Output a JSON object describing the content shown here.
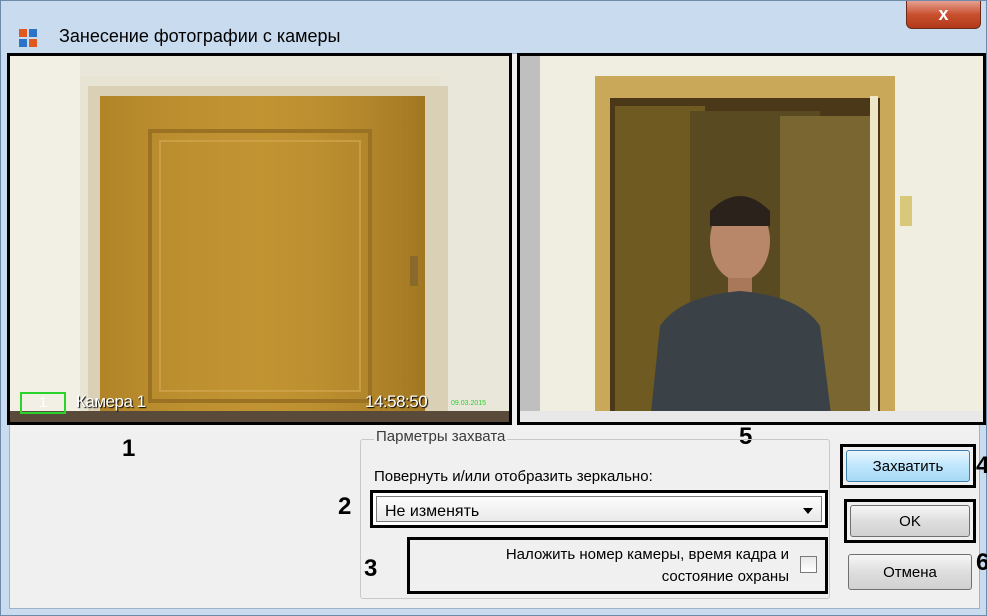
{
  "window": {
    "title": "Занесение фотографии с камеры",
    "close_glyph": "x"
  },
  "video_left": {
    "camera_number": "1",
    "camera_name": "Камера 1",
    "time": "14:58:50",
    "date": "09.03.2015"
  },
  "markers": {
    "m1": "1",
    "m2": "2",
    "m3": "3",
    "m4": "4",
    "m5": "5",
    "m6": "6"
  },
  "capture_params": {
    "group_title": "Парметры захвата",
    "rotate_label": "Повернуть и/или отобразить зеркально:",
    "rotate_value": "Не изменять",
    "overlay_label_line1": "Наложить номер камеры, время кадра и",
    "overlay_label_line2": "состояние охраны",
    "overlay_checked": false
  },
  "buttons": {
    "capture": "Захватить",
    "ok": "OK",
    "cancel": "Отмена"
  },
  "icons": {
    "title": "window-app-icon",
    "dropdown": "chevron-down-icon"
  }
}
